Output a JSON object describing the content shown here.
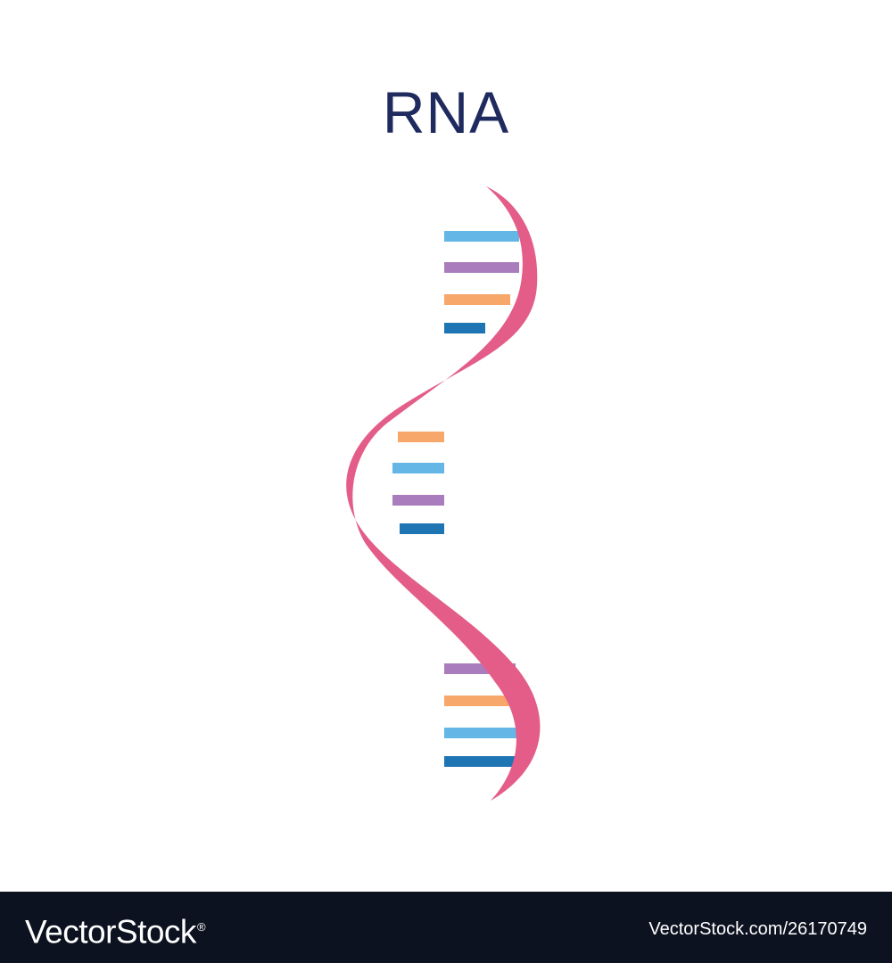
{
  "title": "RNA",
  "colors": {
    "title": "#1f2b5e",
    "strand": "#e35d88",
    "base_light_blue": "#63b6e6",
    "base_purple": "#a97dbd",
    "base_orange": "#f7a76a",
    "base_dark_blue": "#1f74b4",
    "footer_background": "#0d1220",
    "footer_text": "#ffffff"
  },
  "base_groups": [
    {
      "side": "left",
      "bases": [
        "base_light_blue",
        "base_purple",
        "base_orange",
        "base_dark_blue"
      ]
    },
    {
      "side": "right",
      "bases": [
        "base_orange",
        "base_light_blue",
        "base_purple",
        "base_dark_blue"
      ]
    },
    {
      "side": "left",
      "bases": [
        "base_purple",
        "base_orange",
        "base_light_blue",
        "base_dark_blue"
      ]
    }
  ],
  "footer": {
    "brand": "VectorStock",
    "brand_mark": "®",
    "image_id": "VectorStock.com/26170749"
  }
}
